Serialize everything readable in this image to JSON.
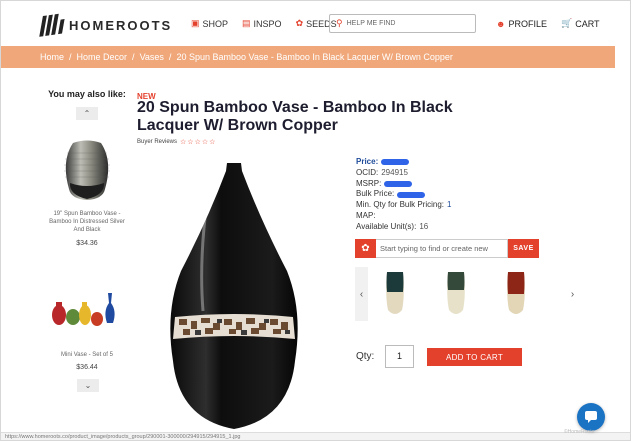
{
  "header": {
    "logo_text": "HOMEROOTS",
    "nav": [
      {
        "label": "SHOP",
        "icon": "bag-icon"
      },
      {
        "label": "INSPO",
        "icon": "book-icon"
      },
      {
        "label": "SEEDS",
        "icon": "leaf-icon"
      }
    ],
    "search_placeholder": "HELP ME FIND",
    "profile_label": "PROFILE",
    "cart_label": "CART"
  },
  "breadcrumb": [
    "Home",
    "Home Decor",
    "Vases",
    "20 Spun Bamboo Vase - Bamboo In Black Lacquer W/ Brown Copper"
  ],
  "sidebar": {
    "title": "You may also like:",
    "items": [
      {
        "name": "19\" Spun Bamboo Vase - Bamboo In Distressed Silver And Black",
        "price": "$34.36"
      },
      {
        "name": "Mini Vase - Set of 5",
        "price": "$36.44"
      }
    ]
  },
  "product": {
    "badge": "NEW",
    "title": "20 Spun Bamboo Vase - Bamboo In Black Lacquer W/ Brown Copper",
    "reviews_label": "Buyer Reviews",
    "stars": "☆☆☆☆☆",
    "price_label": "Price:",
    "ocid_label": "OCID:",
    "ocid_value": "294915",
    "msrp_label": "MSRP:",
    "bulk_label": "Bulk Price:",
    "min_qty_label": "Min. Qty for Bulk Pricing:",
    "min_qty_value": "1",
    "map_label": "MAP:",
    "available_label": "Available Unit(s):",
    "available_value": "16",
    "save_placeholder": "Start typing to find or create new",
    "save_label": "SAVE",
    "qty_label": "Qty:",
    "qty_value": "1",
    "add_to_cart": "ADD TO CART"
  },
  "status_url": "https://www.homeroots.co/product_image/products_group/290001-300000/294915/294915_1.jpg",
  "watermark": "©HomeRoots",
  "colors": {
    "accent": "#e4412d",
    "breadcrumb_bg": "#f0a87b",
    "link_blue": "#1e4b9a",
    "chat": "#1b73c4"
  }
}
